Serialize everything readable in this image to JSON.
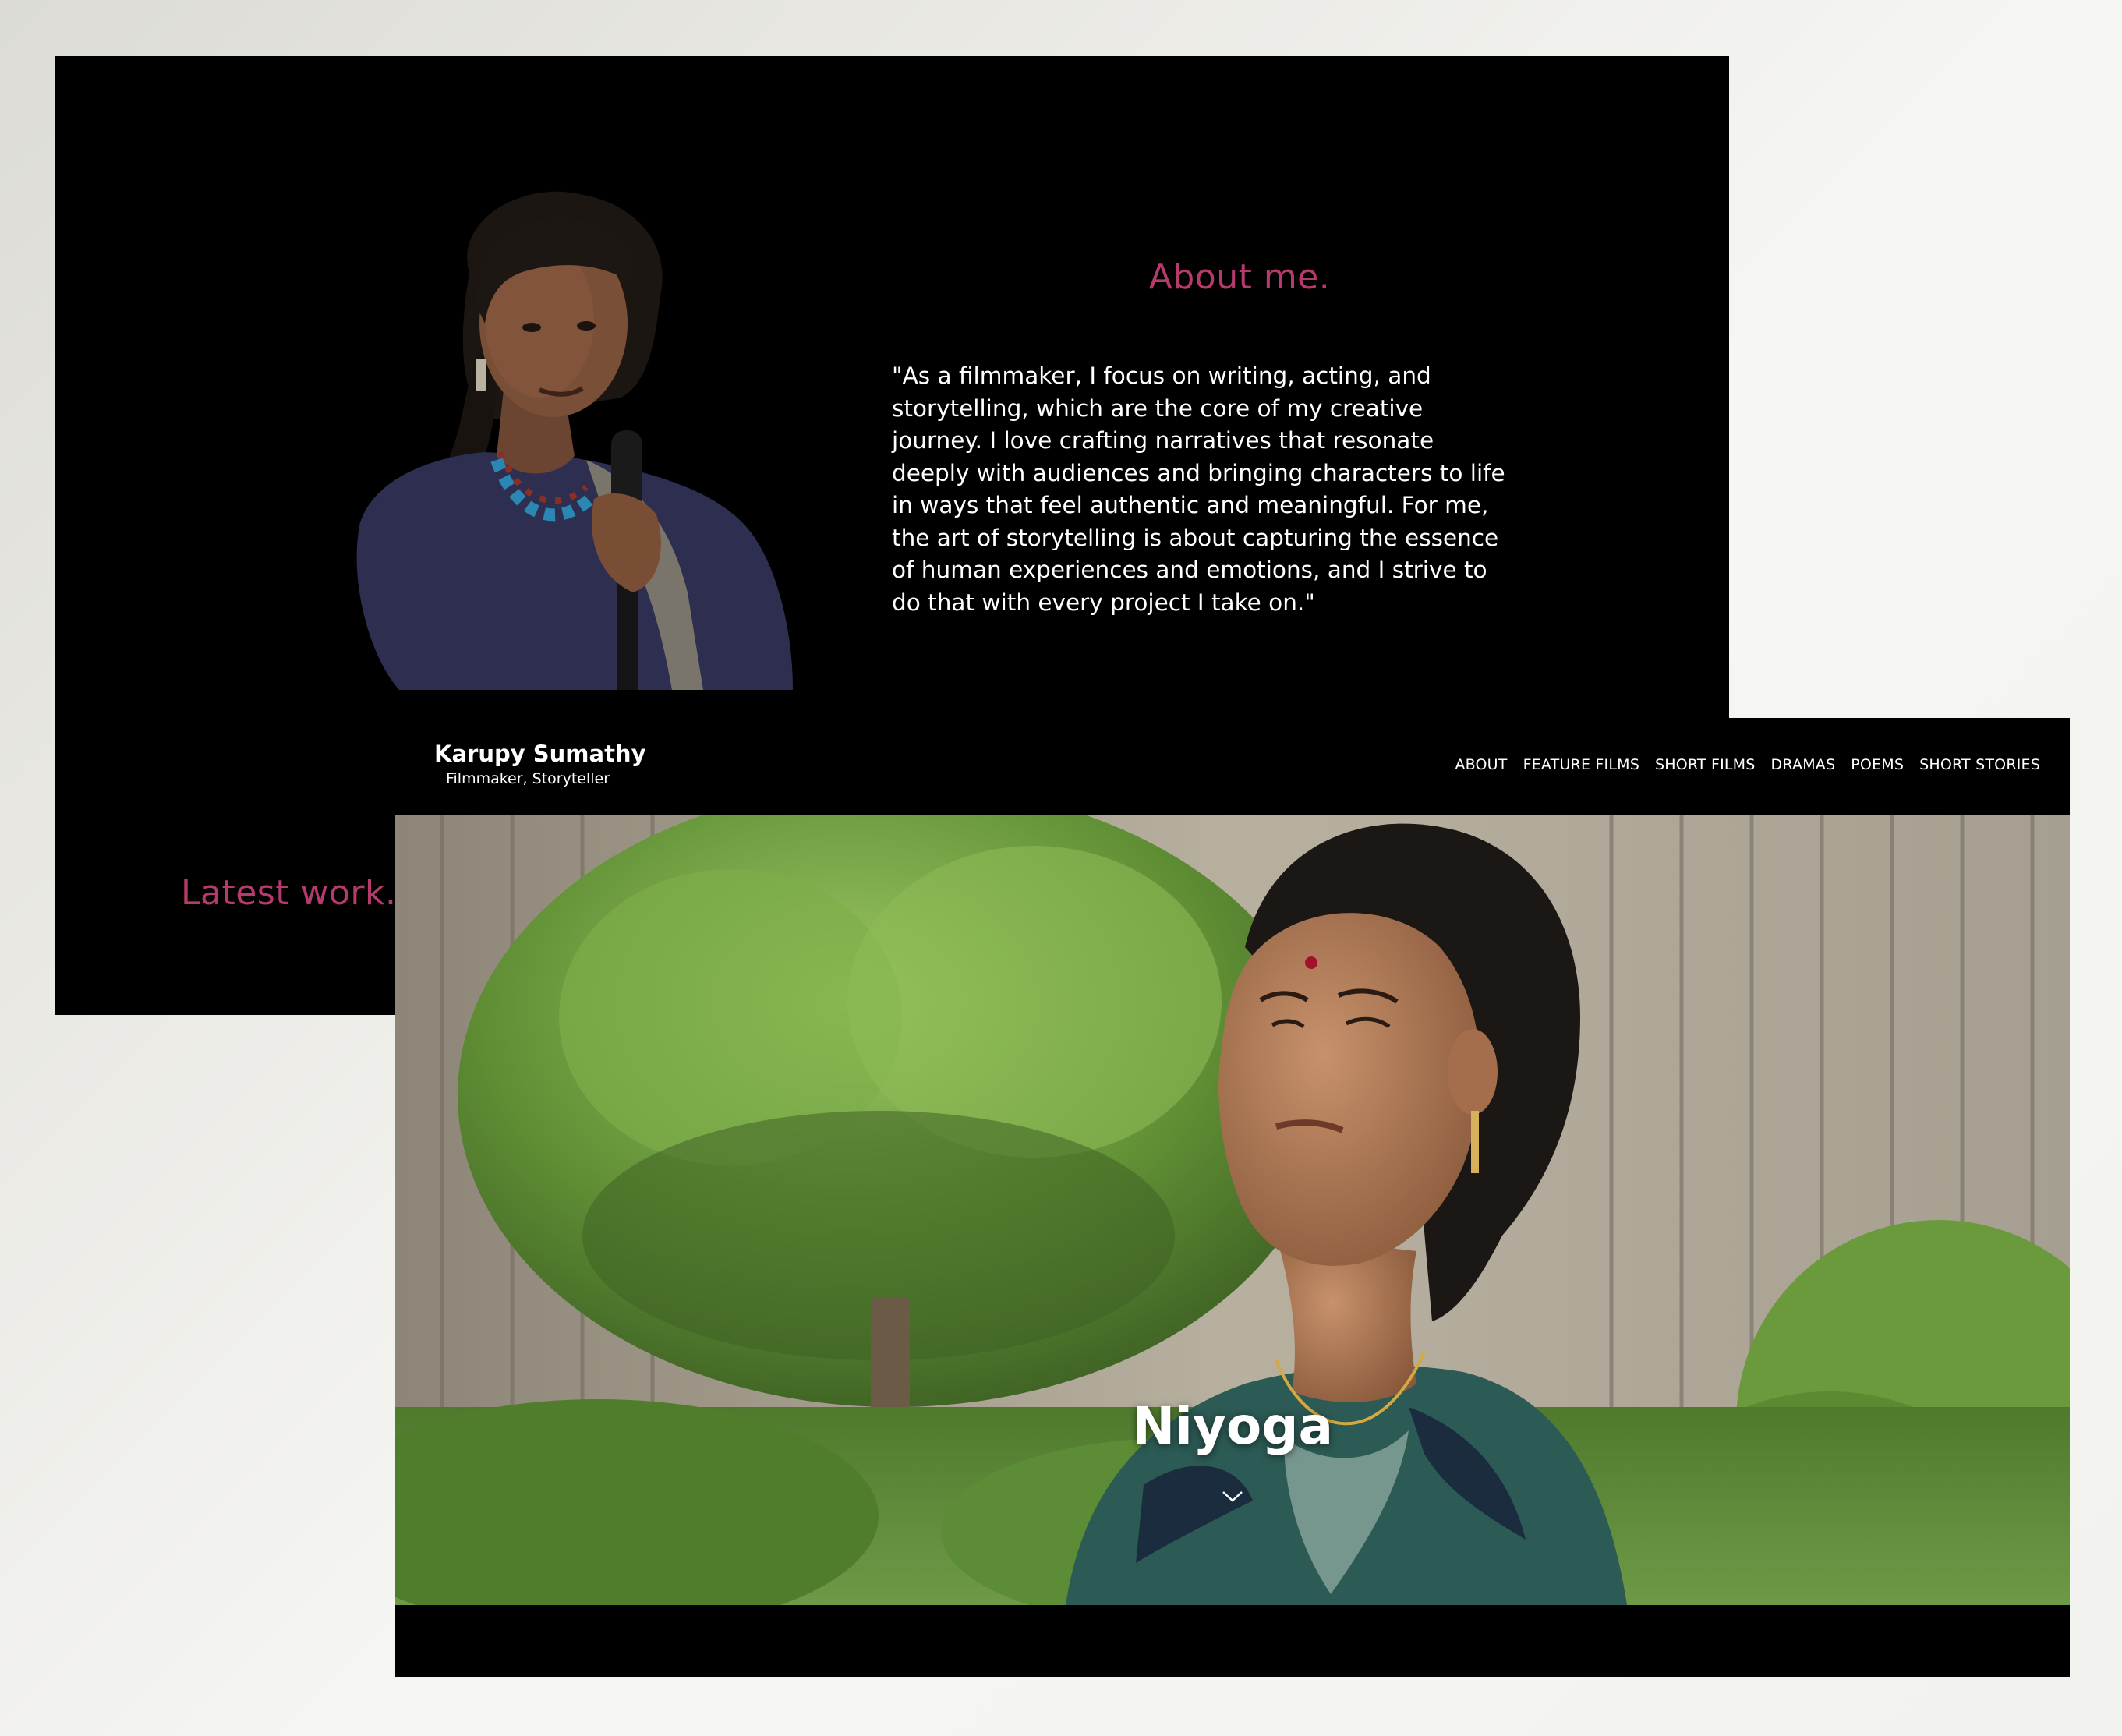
{
  "theme": {
    "accent": "#b73a6f",
    "background": "#000000",
    "text": "#ffffff"
  },
  "about_page": {
    "title": "About me.",
    "quote": "\"As a filmmaker, I focus on writing, acting, and storytelling, which are the core of my creative journey. I love crafting narratives that resonate deeply with audiences and bringing characters to life in ways that feel authentic and meaningful. For me, the art of storytelling is about capturing the essence of human experiences and emotions, and I strive to do that with every project I take on.\"",
    "latest_heading": "Latest work.",
    "portrait_icon": "portrait-photo"
  },
  "home_page": {
    "brand": {
      "name": "Karupy Sumathy",
      "tagline": "Filmmaker, Storyteller"
    },
    "nav": [
      {
        "label": "ABOUT"
      },
      {
        "label": "FEATURE FILMS"
      },
      {
        "label": "SHORT FILMS"
      },
      {
        "label": "DRAMAS"
      },
      {
        "label": "POEMS"
      },
      {
        "label": "SHORT STORIES"
      }
    ],
    "hero": {
      "title": "Niyoga",
      "scroll_icon": "chevron-down-icon"
    }
  }
}
